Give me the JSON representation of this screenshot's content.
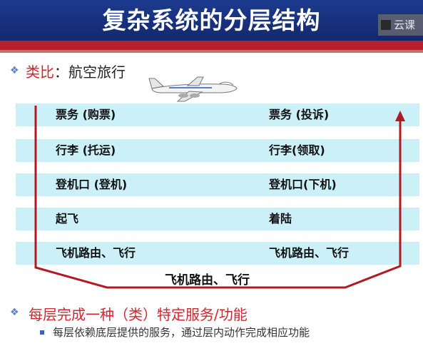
{
  "title": "复杂系统的分层结构",
  "watermark": "云课",
  "analogy": {
    "lead": "类比",
    "rest": "：航空旅行"
  },
  "layers": [
    {
      "left": "票务 (购票)",
      "right": "票务 (投诉)"
    },
    {
      "left": "行李 (托运)",
      "right": "行李(领取)"
    },
    {
      "left": "登机口 (登机)",
      "right": "登机口(下机)"
    },
    {
      "left": "起飞",
      "right": "着陆"
    },
    {
      "left": "飞机路由、飞行",
      "right": "飞机路由、飞行"
    }
  ],
  "bottom_label": "飞机路由、飞行",
  "point2": "每层完成一种（类）特定服务/功能",
  "subpoint": "每层依赖底层提供的服务，通过层内动作完成相应功能",
  "colors": {
    "title_bg": "#1c3a8e",
    "accent_red": "#b5202a",
    "row_bg": "#cbf0f8",
    "arrow": "#b01a22"
  },
  "icons": {
    "bullet": "diamond-bullet-icon",
    "plane": "airplane-icon"
  }
}
